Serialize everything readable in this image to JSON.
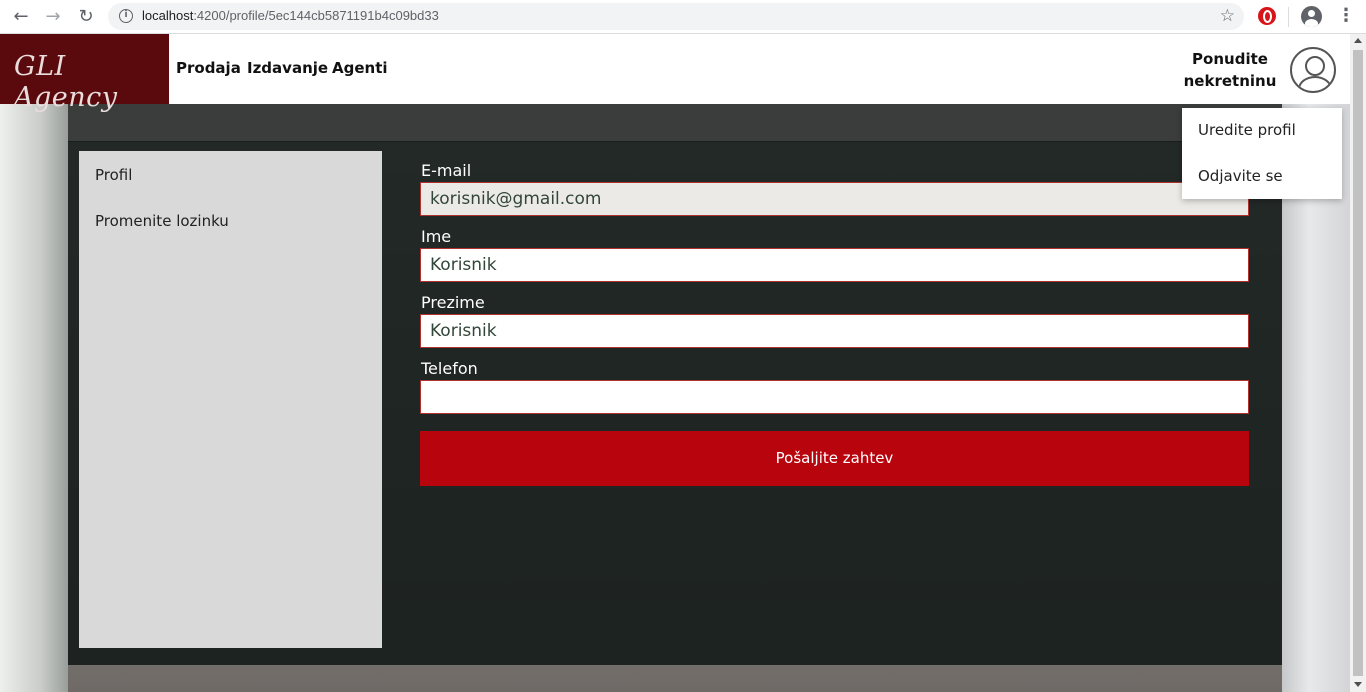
{
  "browser": {
    "url_host": "localhost",
    "url_rest": ":4200/profile/5ec144cb5871191b4c09bd33",
    "icons": [
      "back-arrow-icon",
      "forward-arrow-icon",
      "reload-icon",
      "info-icon",
      "star-icon",
      "opera-icon",
      "account-icon",
      "kebab-menu-icon"
    ]
  },
  "navbar": {
    "brand": "GLI Agency",
    "links": [
      "Prodaja",
      "Izdavanje",
      "Agenti"
    ],
    "offer_line1": "Ponudite",
    "offer_line2": "nekretninu",
    "brand_color": "#5a0a0c"
  },
  "dropdown": {
    "items": [
      "Uredite profil",
      "Odjavite se"
    ]
  },
  "sidebar": {
    "items": [
      "Profil",
      "Promenite lozinku"
    ]
  },
  "form": {
    "fields": [
      {
        "label": "E-mail",
        "value": "korisnik@gmail.com"
      },
      {
        "label": "Ime",
        "value": "Korisnik"
      },
      {
        "label": "Prezime",
        "value": "Korisnik"
      },
      {
        "label": "Telefon",
        "value": ""
      }
    ],
    "submit_label": "Pošaljite zahtev",
    "submit_color": "#b8040d"
  }
}
